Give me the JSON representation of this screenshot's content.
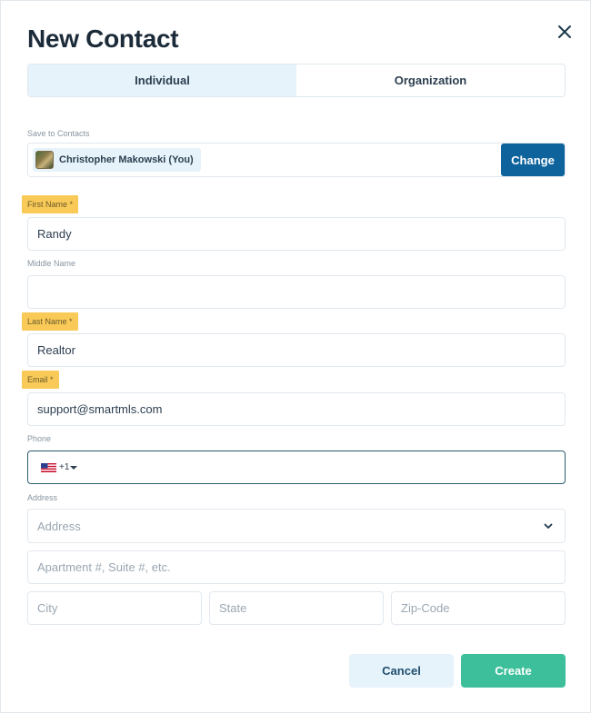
{
  "dialog": {
    "title": "New Contact"
  },
  "tabs": [
    {
      "label": "Individual",
      "active": true
    },
    {
      "label": "Organization",
      "active": false
    }
  ],
  "save_to": {
    "label": "Save to Contacts",
    "owner": "Christopher Makowski (You)",
    "change_label": "Change"
  },
  "fields": {
    "first_name": {
      "label": "First Name",
      "required_mark": "*",
      "value": "Randy"
    },
    "middle_name": {
      "label": "Middle Name",
      "value": ""
    },
    "last_name": {
      "label": "Last Name",
      "required_mark": "*",
      "value": "Realtor"
    },
    "email": {
      "label": "Email",
      "required_mark": "*",
      "value": "support@smartmls.com"
    },
    "phone": {
      "label": "Phone",
      "country_code": "+1",
      "flag": "us-flag-icon",
      "value": ""
    },
    "address": {
      "label": "Address",
      "address_placeholder": "Address",
      "apartment_placeholder": "Apartment #, Suite #, etc.",
      "city_placeholder": "City",
      "state_placeholder": "State",
      "zip_placeholder": "Zip-Code"
    }
  },
  "actions": {
    "cancel_label": "Cancel",
    "create_label": "Create"
  },
  "colors": {
    "primary": "#0e639c",
    "create": "#3cbf9a",
    "required_highlight": "#f9ca57",
    "active_tab": "#e6f3fb"
  }
}
